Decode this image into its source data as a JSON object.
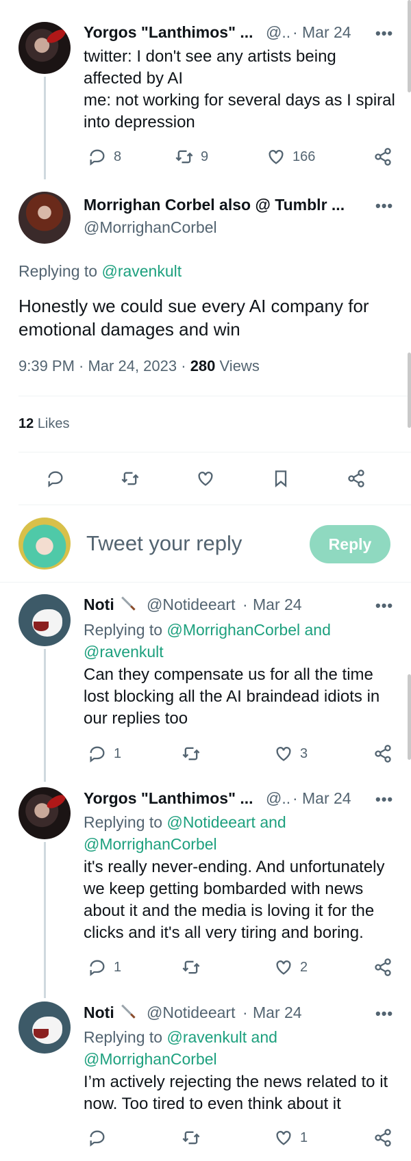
{
  "tweets": [
    {
      "name": "Yorgos \"Lanthimos\" ...",
      "handle": "@..",
      "date": "Mar 24",
      "text_lines": [
        "twitter: I don't see any artists being",
        "affected by AI",
        "me: not working for several days as I spiral",
        "into depression"
      ],
      "replies": "8",
      "retweets": "9",
      "likes": "166"
    },
    {
      "name": "Noti",
      "handle": "@Notideeart",
      "date": "Mar 24",
      "replying_prefix": "Replying to",
      "replying_a": "@MorrighanCorbel and",
      "replying_b": "@ravenkult",
      "text_lines": [
        "Can they compensate us for all the time",
        "lost blocking all the AI braindead idiots in",
        "our replies too"
      ],
      "replies": "1",
      "retweets": "",
      "likes": "3"
    },
    {
      "name": "Yorgos \"Lanthimos\" ...",
      "handle": "@..",
      "date": "Mar 24",
      "replying_prefix": "Replying to",
      "replying_a": "@Notideeart and",
      "replying_b": "@MorrighanCorbel",
      "text_lines": [
        "it's really never-ending. And unfortunately",
        "we keep getting bombarded with news",
        "about it and the media is loving it for the",
        "clicks and it's all very tiring and boring."
      ],
      "replies": "1",
      "retweets": "",
      "likes": "2"
    },
    {
      "name": "Noti",
      "handle": "@Notideeart",
      "date": "Mar 24",
      "replying_prefix": "Replying to",
      "replying_a": "@ravenkult and",
      "replying_b": "@MorrighanCorbel",
      "text_lines": [
        "I’m actively rejecting the news related to it",
        "now. Too tired to even think about it"
      ],
      "replies": "",
      "retweets": "",
      "likes": "1"
    }
  ],
  "main_tweet": {
    "name": "Morrighan Corbel also @ Tumblr ...",
    "handle": "@MorrighanCorbel",
    "replying_prefix": "Replying to",
    "replying_to": "@ravenkult",
    "text_lines": [
      "Honestly we could sue every AI company for",
      "emotional damages and win"
    ],
    "timestamp": "9:39 PM · Mar 24, 2023 ·",
    "views_count": "280",
    "views_label": "Views",
    "likes_count": "12",
    "likes_label": "Likes"
  },
  "reply_box": {
    "placeholder": "Tweet your reply",
    "button_label": "Reply"
  },
  "separator": "·",
  "more": "•••",
  "colors": {
    "link": "#1da07e",
    "reply_button": "#8fd9c0",
    "muted": "#536471"
  }
}
